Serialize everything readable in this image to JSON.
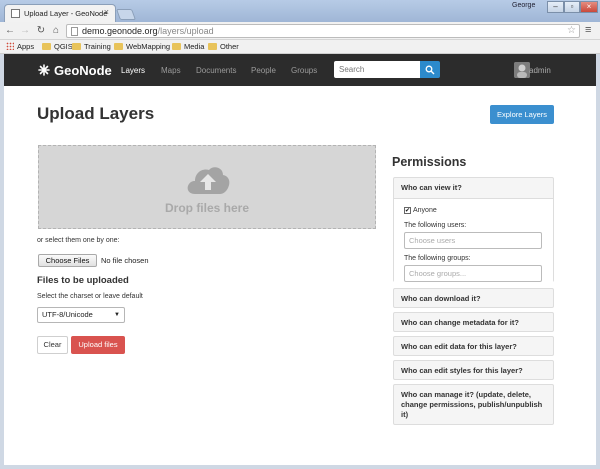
{
  "browser": {
    "tab_title": "Upload Layer - GeoNode",
    "user": "George",
    "url_host": "demo.geonode.org",
    "url_path": "/layers/upload",
    "bookmarks": [
      "Apps",
      "QGIS",
      "Training",
      "WebMapping",
      "Media",
      "Other"
    ]
  },
  "nav": {
    "brand": "GeoNode",
    "links": [
      "Layers",
      "Maps",
      "Documents",
      "People",
      "Groups"
    ],
    "active": "Layers",
    "search_placeholder": "Search",
    "user": "admin"
  },
  "main": {
    "title": "Upload Layers",
    "explore_label": "Explore Layers",
    "drop_text": "Drop files here",
    "select_one": "or select them one by one:",
    "choose_files": "Choose Files",
    "no_file": "No file chosen",
    "files_heading": "Files to be uploaded",
    "charset_label": "Select the charset or leave default",
    "charset_value": "UTF-8/Unicode",
    "clear_label": "Clear",
    "upload_label": "Upload files"
  },
  "permissions": {
    "title": "Permissions",
    "view": {
      "heading": "Who can view it?",
      "anyone_label": "Anyone",
      "anyone_checked": true,
      "users_label": "The following users:",
      "users_placeholder": "Choose users",
      "groups_label": "The following groups:",
      "groups_placeholder": "Choose groups..."
    },
    "download": "Who can download it?",
    "metadata": "Who can change metadata for it?",
    "edit_data": "Who can edit data for this layer?",
    "edit_styles": "Who can edit styles for this layer?",
    "manage": "Who can manage it? (update, delete, change permissions, publish/unpublish it)"
  },
  "colors": {
    "navbar": "#2c2c2c",
    "primary": "#3b8fcf",
    "danger": "#d9534f"
  }
}
